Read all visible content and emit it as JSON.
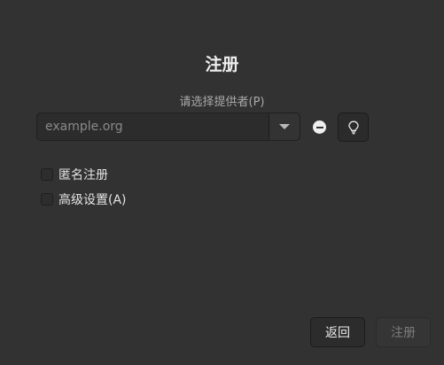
{
  "dialog": {
    "title": "注册",
    "provider_label": "请选择提供者(P)",
    "provider_input": {
      "value": "",
      "placeholder": "example.org"
    },
    "options": [
      {
        "label": "匿名注册",
        "checked": false
      },
      {
        "label": "高级设置(A)",
        "checked": false
      }
    ],
    "buttons": {
      "back_label": "返回",
      "register_label": "注册"
    },
    "icons": {
      "dropdown": "chevron-down-icon",
      "remove": "remove-icon",
      "hint": "lightbulb-icon"
    },
    "colors": {
      "background": "#323232",
      "text": "#e8e8e8",
      "muted_text": "#a9a9a9",
      "disabled_text": "#7c7c7c"
    }
  }
}
